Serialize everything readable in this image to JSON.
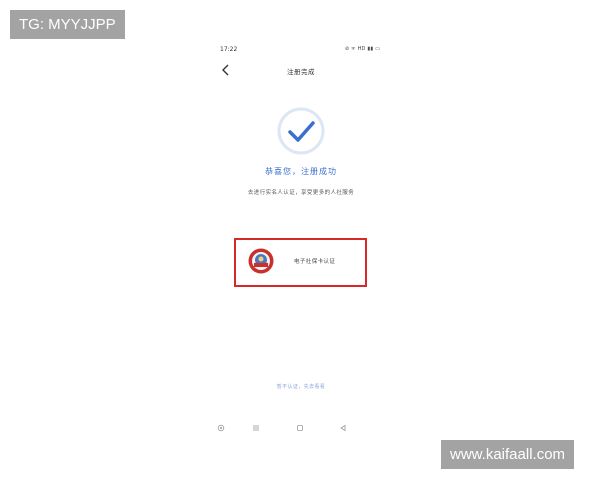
{
  "watermarks": {
    "top": "TG: MYYJJPP",
    "bottom": "www.kaifaall.com"
  },
  "status_bar": {
    "time": "17:22",
    "icons_text": "⊘ ᯤ HD ▮▮ ▭"
  },
  "header": {
    "title": "注册完成"
  },
  "success": {
    "message": "恭喜您，注册成功",
    "subtitle": "去进行实名人认证，享受更多的人社服务"
  },
  "auth_option": {
    "label": "电子社保卡认证",
    "icon": "social-security-emblem-icon"
  },
  "footer": {
    "link": "暂不认证，先去看看"
  },
  "nav_bar": {
    "icons": [
      "settings-icon",
      "menu-icon",
      "home-icon",
      "back-triangle-icon"
    ]
  },
  "colors": {
    "accent": "#3a6fd0",
    "highlight_border": "#d62a2a",
    "check_ring": "#dde6f5"
  }
}
